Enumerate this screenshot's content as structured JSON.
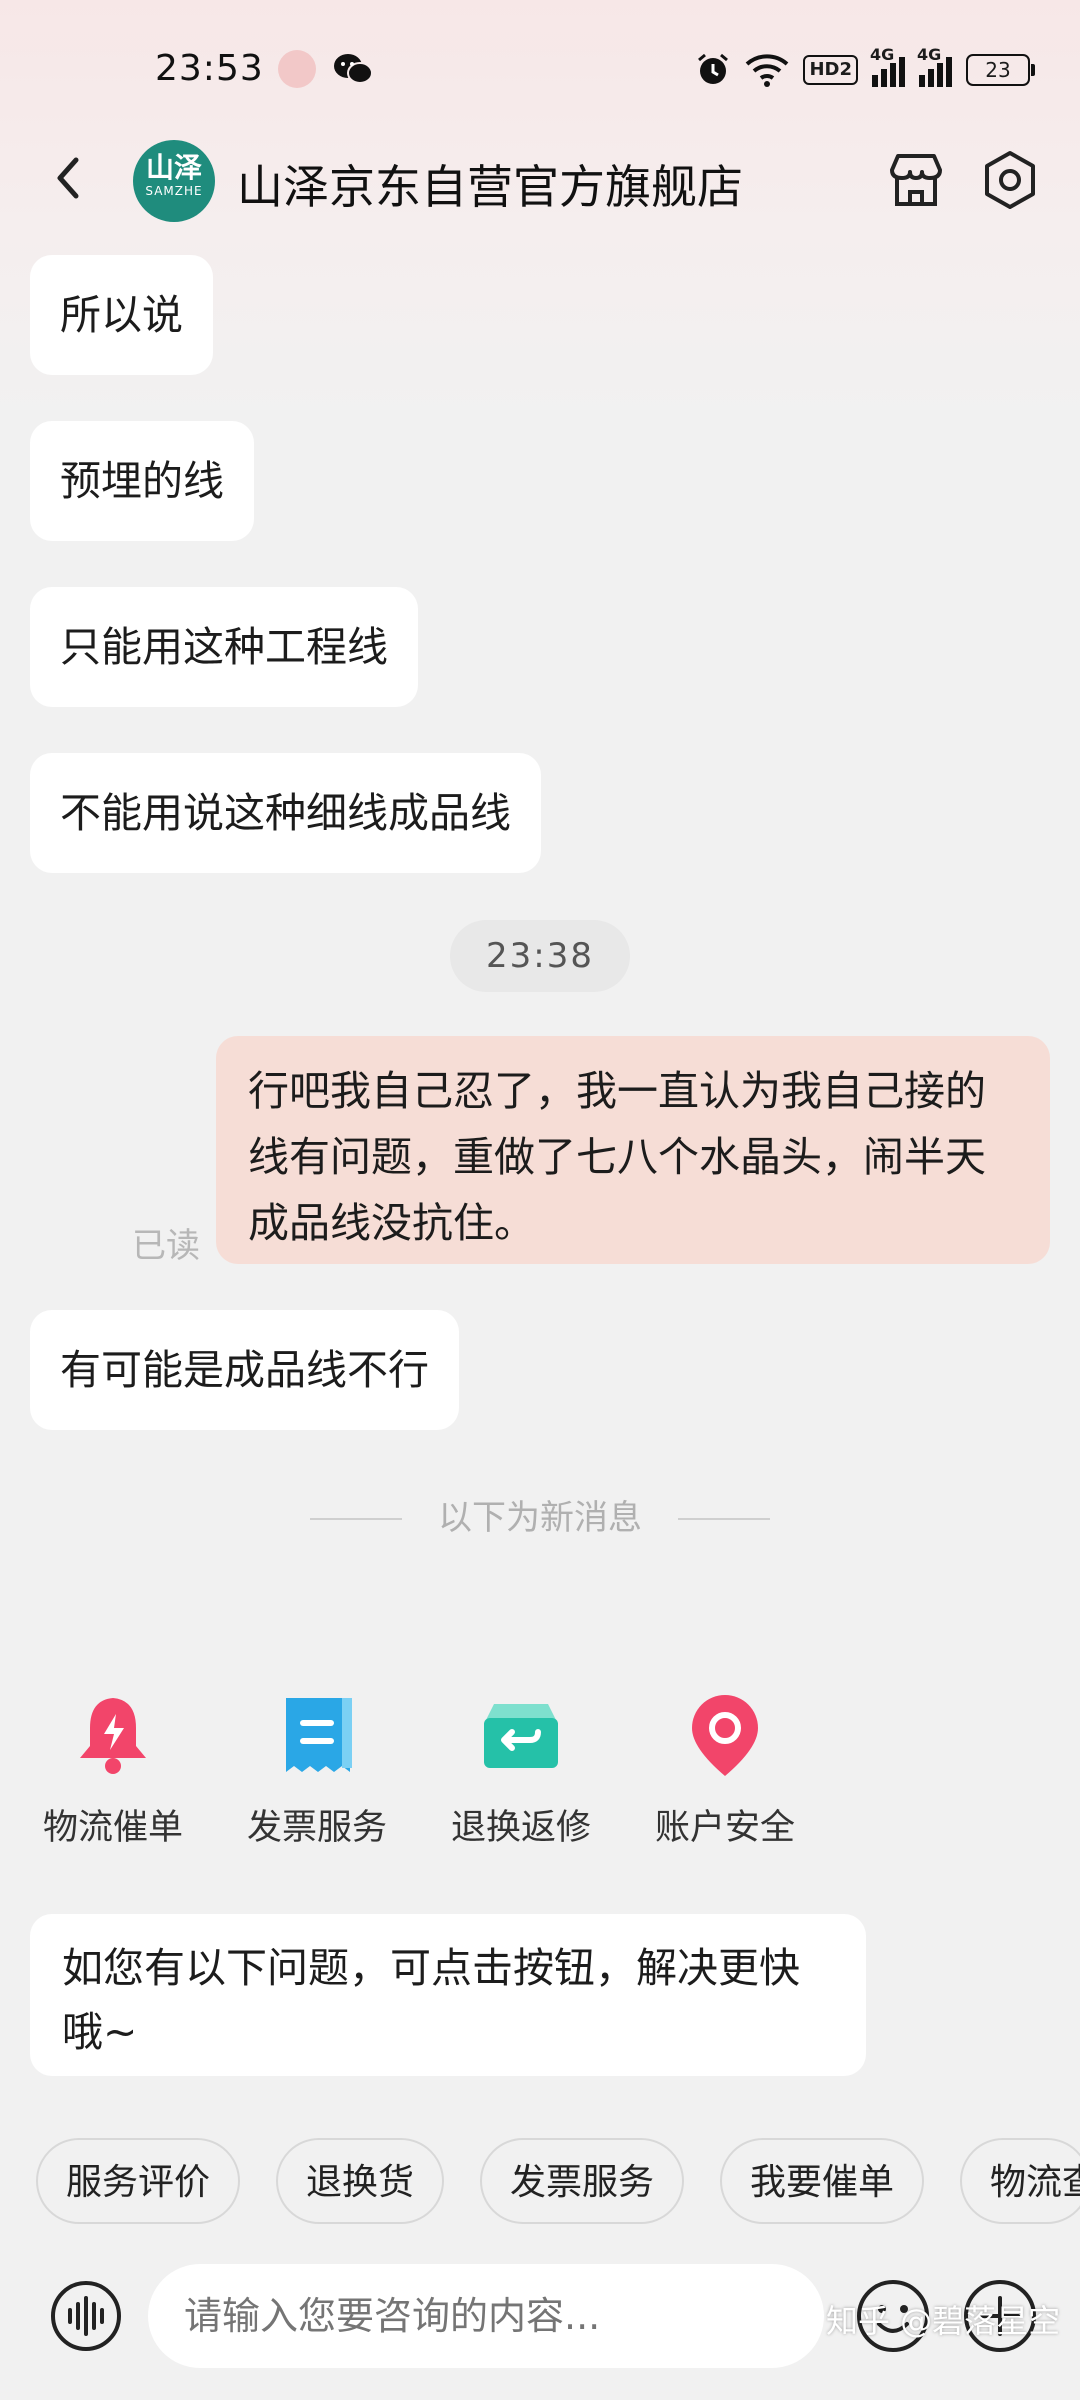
{
  "status_bar": {
    "time": "23:53",
    "hd_badge": "HD2",
    "signal1": "4G",
    "signal2": "4G",
    "battery": "23"
  },
  "header": {
    "logo_line1": "山泽",
    "logo_line2": "SAMZHE",
    "title": "山泽京东自营官方旗舰店"
  },
  "messages": {
    "m1": "所以说",
    "m2": "预埋的线",
    "m3": "只能用这种工程线",
    "m4": "不能用说这种细线成品线",
    "timestamp": "23:38",
    "outgoing": "行吧我自己忍了，我一直认为我自己接的线有问题，重做了七八个水晶头，闹半天成品线没抗住。",
    "read_status": "已读",
    "m5": "有可能是成品线不行",
    "new_divider": "以下为新消息",
    "prompt": "如您有以下问题，可点击按钮，解决更快哦~"
  },
  "quick_actions": [
    {
      "label": "物流催单",
      "icon": "bell-icon",
      "color": "#f2456a"
    },
    {
      "label": "发票服务",
      "icon": "invoice-icon",
      "color": "#2aa7e6"
    },
    {
      "label": "退换返修",
      "icon": "return-icon",
      "color": "#25c1a8"
    },
    {
      "label": "账户安全",
      "icon": "location-icon",
      "color": "#f2456a"
    }
  ],
  "chips": [
    "服务评价",
    "退换货",
    "发票服务",
    "我要催单",
    "物流查"
  ],
  "input": {
    "placeholder": "请输入您要咨询的内容..."
  },
  "watermark": "知乎 @碧落星空"
}
